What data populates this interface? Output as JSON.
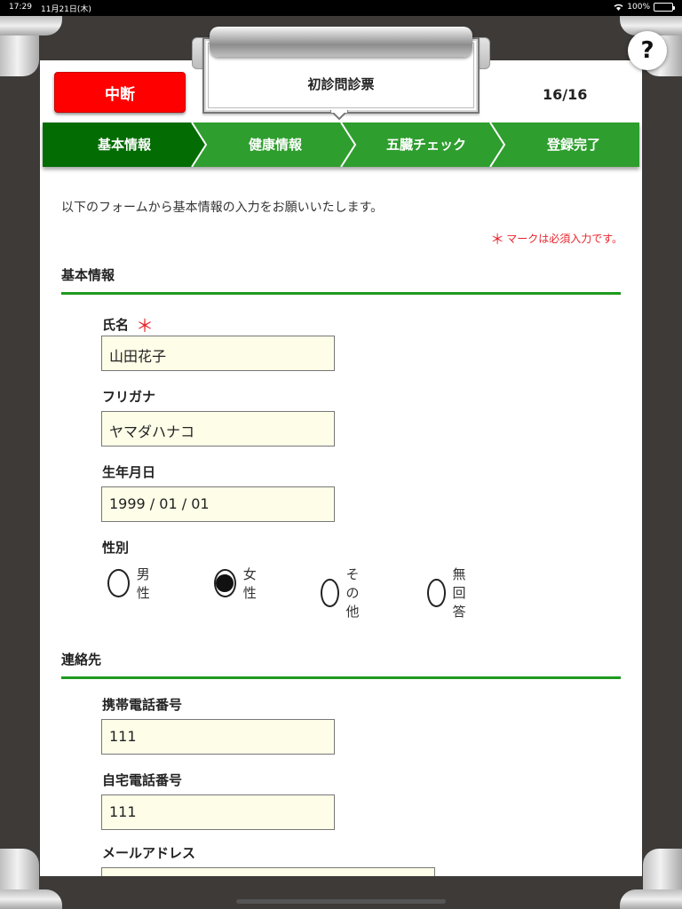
{
  "status_bar": {
    "time": "17:29",
    "date": "11月21日(木)",
    "battery": "100%"
  },
  "clipboard": {
    "title": "初診問診票"
  },
  "header": {
    "abort_label": "中断",
    "page_count": "16/16",
    "help_label": "?"
  },
  "steps": [
    {
      "label": "基本情報",
      "active": true
    },
    {
      "label": "健康情報",
      "active": false
    },
    {
      "label": "五臓チェック",
      "active": false
    },
    {
      "label": "登録完了",
      "active": false
    }
  ],
  "colors": {
    "step_active": "#036c03",
    "step_inactive": "#2e9e2e",
    "accent_red": "#ff0000",
    "section_line": "#1e9a1e",
    "input_bg": "#fefde8"
  },
  "form": {
    "intro": "以下のフォームから基本情報の入力をお願いいたします。",
    "required_note": "マークは必須入力です。",
    "required_mark": "＊",
    "sections": {
      "basic": {
        "title": "基本情報",
        "name": {
          "label": "氏名",
          "value": "山田花子"
        },
        "furigana": {
          "label": "フリガナ",
          "value": "ヤマダハナコ"
        },
        "birthdate": {
          "label": "生年月日",
          "value": "1999 / 01 / 01"
        },
        "gender": {
          "label": "性別",
          "options": [
            "男性",
            "女性",
            "その他",
            "無回答"
          ],
          "selected": "女性"
        }
      },
      "contact": {
        "title": "連絡先",
        "mobile": {
          "label": "携帯電話番号",
          "value": "111"
        },
        "home": {
          "label": "自宅電話番号",
          "value": "111"
        },
        "email": {
          "label": "メールアドレス",
          "value": ""
        }
      }
    }
  }
}
